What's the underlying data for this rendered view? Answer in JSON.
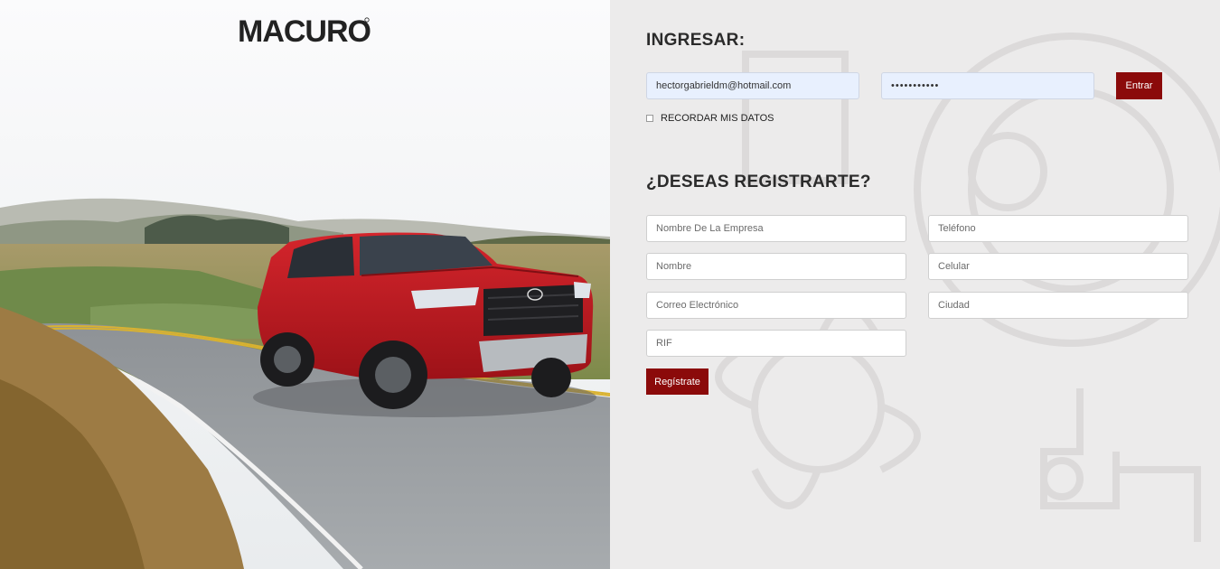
{
  "brand": {
    "logo_text": "MACURO"
  },
  "login": {
    "heading": "INGRESAR:",
    "email_value": "hectorgabrieldm@hotmail.com",
    "password_value": "•••••••••••",
    "submit_label": "Entrar",
    "remember_label": "RECORDAR MIS DATOS"
  },
  "register": {
    "heading": "¿DESEAS REGISTRARTE?",
    "fields": {
      "company": "Nombre De La Empresa",
      "phone": "Teléfono",
      "name": "Nombre",
      "mobile": "Celular",
      "email": "Correo Electrónico",
      "city": "Ciudad",
      "rif": "RIF"
    },
    "submit_label": "Regístrate"
  },
  "colors": {
    "accent": "#8b0a0a",
    "panel_bg": "#ecebeb",
    "autofill_bg": "#e8f0fe"
  }
}
